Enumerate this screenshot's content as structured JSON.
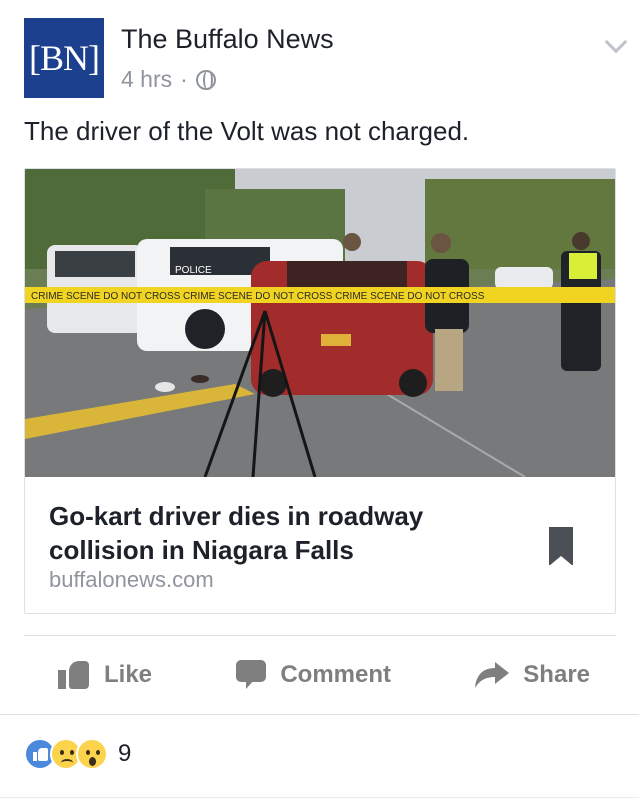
{
  "post": {
    "page_name": "The Buffalo News",
    "logo_text": "[BN]",
    "timestamp": "4 hrs",
    "separator": "·",
    "privacy_icon": "globe-icon",
    "menu_icon": "chevron-down-icon",
    "text": "The driver of the Volt was not charged."
  },
  "link_card": {
    "image_alt": "Crime scene photo: police vehicles, a red car and officers behind yellow tape on a road",
    "title": "Go-kart driver dies in roadway collision in Niagara Falls",
    "domain": "buffalonews.com",
    "tape_text": "CRIME SCENE DO NOT CROSS CRIME SCENE DO NOT CROSS CRIME SCENE DO NOT CROSS",
    "police_text": "POLICE",
    "save_icon": "bookmark-icon"
  },
  "actions": {
    "like_label": "Like",
    "comment_label": "Comment",
    "share_label": "Share"
  },
  "reactions": {
    "types": [
      "like",
      "sad",
      "wow"
    ],
    "count": "9"
  },
  "colors": {
    "logo_bg": "#1c3f8e",
    "secondary_text": "#90949c",
    "action_gray": "#7f7f7f",
    "like_blue": "#4a89dc"
  }
}
